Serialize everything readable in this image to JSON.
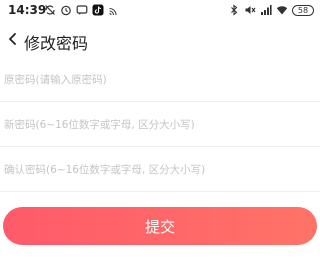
{
  "status_bar": {
    "time": "14:39",
    "battery": "58",
    "icons": [
      "sync-off-icon",
      "alarm-icon",
      "message-icon",
      "tiktok-icon",
      "cast-icon",
      "bluetooth-icon",
      "mute-icon",
      "signal-icon",
      "wifi-icon",
      "battery-icon"
    ]
  },
  "nav": {
    "title": "修改密码",
    "back_icon": "chevron-left-icon"
  },
  "form": {
    "old_password": {
      "placeholder": "原密码(请输入原密码)",
      "value": ""
    },
    "new_password": {
      "placeholder": "新密码(6~16位数字或字母, 区分大小写)",
      "value": ""
    },
    "confirm_password": {
      "placeholder": "确认密码(6~16位数字或字母, 区分大小写)",
      "value": ""
    }
  },
  "submit": {
    "label": "提交"
  },
  "colors": {
    "accent_start": "#ff5a6a",
    "accent_end": "#ff7367",
    "placeholder": "#c4c4c4"
  }
}
